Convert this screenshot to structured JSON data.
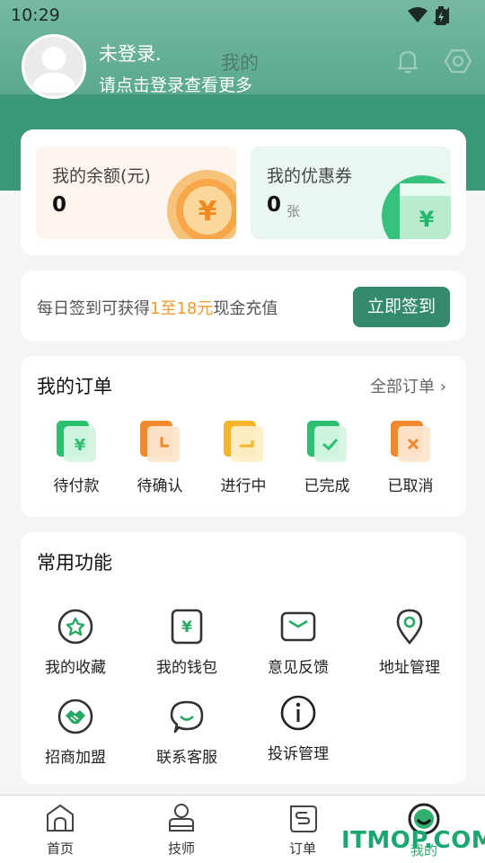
{
  "status_bar": {
    "time": "10:29"
  },
  "header": {
    "title": "我的",
    "login_title": "未登录.",
    "login_subtitle": "请点击登录查看更多"
  },
  "wallet": {
    "balance_label": "我的余额(元)",
    "balance_value": "0",
    "coupon_label": "我的优惠券",
    "coupon_value": "0",
    "coupon_unit": "张"
  },
  "signin": {
    "text_prefix": "每日签到可获得",
    "text_highlight": "1至18元",
    "text_suffix": "现金充值",
    "button": "立即签到"
  },
  "orders": {
    "title": "我的订单",
    "all_label": "全部订单",
    "items": [
      {
        "label": "待付款",
        "icon": "yen-wallet-icon",
        "color": "#2dbf6f"
      },
      {
        "label": "待确认",
        "icon": "clock-icon",
        "color": "#f28a2c"
      },
      {
        "label": "进行中",
        "icon": "progress-icon",
        "color": "#f5b52a"
      },
      {
        "label": "已完成",
        "icon": "check-icon",
        "color": "#2dbf6f"
      },
      {
        "label": "已取消",
        "icon": "cancel-icon",
        "color": "#f28a2c"
      }
    ]
  },
  "functions": {
    "title": "常用功能",
    "items": [
      {
        "label": "我的收藏",
        "icon": "star-icon"
      },
      {
        "label": "我的钱包",
        "icon": "wallet-icon"
      },
      {
        "label": "意见反馈",
        "icon": "mail-icon"
      },
      {
        "label": "地址管理",
        "icon": "location-icon"
      },
      {
        "label": "招商加盟",
        "icon": "handshake-icon"
      },
      {
        "label": "联系客服",
        "icon": "chat-icon"
      },
      {
        "label": "投诉管理",
        "icon": "info-icon"
      }
    ]
  },
  "bottom_nav": {
    "items": [
      {
        "label": "首页",
        "icon": "home-icon"
      },
      {
        "label": "技师",
        "icon": "technician-icon"
      },
      {
        "label": "订单",
        "icon": "order-icon"
      },
      {
        "label": "我的",
        "icon": "profile-icon",
        "active": true
      }
    ]
  },
  "watermark": "ITMOP.COM",
  "colors": {
    "primary": "#338a6e",
    "highlight": "#f39a2a"
  }
}
